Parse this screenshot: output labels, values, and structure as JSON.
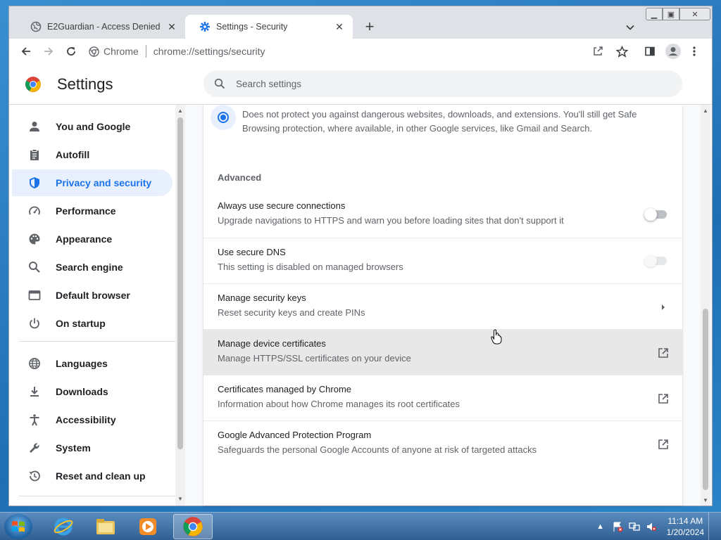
{
  "browser": {
    "tabs": [
      {
        "title": "E2Guardian - Access Denied",
        "active": false
      },
      {
        "title": "Settings - Security",
        "active": true
      }
    ],
    "omnibox": {
      "scheme_label": "Chrome",
      "url_host": "chrome://",
      "url_path": "settings/security"
    }
  },
  "settings": {
    "title": "Settings",
    "search_placeholder": "Search settings"
  },
  "sidebar": {
    "items": [
      {
        "label": "You and Google",
        "icon": "person-icon",
        "active": false
      },
      {
        "label": "Autofill",
        "icon": "clipboard-icon",
        "active": false
      },
      {
        "label": "Privacy and security",
        "icon": "shield-icon",
        "active": true
      },
      {
        "label": "Performance",
        "icon": "speedometer-icon",
        "active": false
      },
      {
        "label": "Appearance",
        "icon": "palette-icon",
        "active": false
      },
      {
        "label": "Search engine",
        "icon": "search-icon",
        "active": false
      },
      {
        "label": "Default browser",
        "icon": "browser-icon",
        "active": false
      },
      {
        "label": "On startup",
        "icon": "power-icon",
        "active": false
      },
      {
        "label": "Languages",
        "icon": "globe-icon",
        "active": false
      },
      {
        "label": "Downloads",
        "icon": "download-icon",
        "active": false
      },
      {
        "label": "Accessibility",
        "icon": "accessibility-icon",
        "active": false
      },
      {
        "label": "System",
        "icon": "wrench-icon",
        "active": false
      },
      {
        "label": "Reset and clean up",
        "icon": "history-icon",
        "active": false
      }
    ]
  },
  "main": {
    "no_protection_desc": "Does not protect you against dangerous websites, downloads, and extensions. You'll still get Safe Browsing protection, where available, in other Google services, like Gmail and Search.",
    "advanced_title": "Advanced",
    "rows": [
      {
        "label": "Always use secure connections",
        "sub": "Upgrade navigations to HTTPS and warn you before loading sites that don't support it",
        "control": "toggle"
      },
      {
        "label": "Use secure DNS",
        "sub": "This setting is disabled on managed browsers",
        "control": "toggle-disabled"
      },
      {
        "label": "Manage security keys",
        "sub": "Reset security keys and create PINs",
        "control": "arrow"
      },
      {
        "label": "Manage device certificates",
        "sub": "Manage HTTPS/SSL certificates on your device",
        "control": "external"
      },
      {
        "label": "Certificates managed by Chrome",
        "sub": "Information about how Chrome manages its root certificates",
        "control": "external"
      },
      {
        "label": "Google Advanced Protection Program",
        "sub": "Safeguards the personal Google Accounts of anyone at risk of targeted attacks",
        "control": "external"
      }
    ]
  },
  "taskbar": {
    "time": "11:14 AM",
    "date": "1/20/2024"
  },
  "colors": {
    "accent": "#1a73e8",
    "active_nav_bg": "#e8f0fe"
  }
}
